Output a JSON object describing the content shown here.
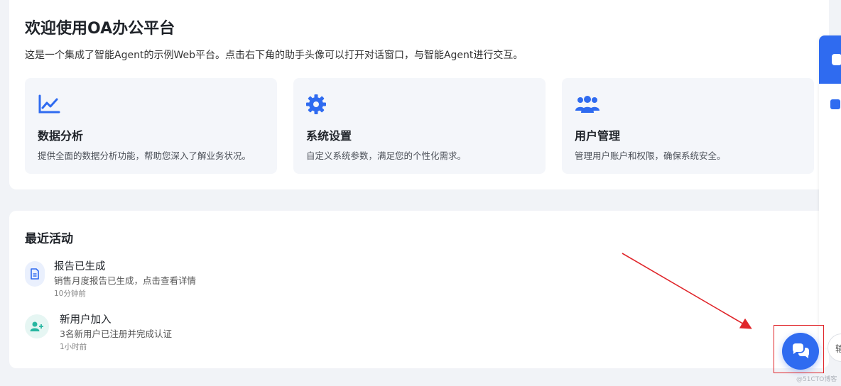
{
  "welcome": {
    "title": "欢迎使用OA办公平台",
    "subtitle": "这是一个集成了智能Agent的示例Web平台。点击右下角的助手头像可以打开对话窗口，与智能Agent进行交互。"
  },
  "features": [
    {
      "icon": "line-chart-icon",
      "title": "数据分析",
      "desc": "提供全面的数据分析功能，帮助您深入了解业务状况。"
    },
    {
      "icon": "gear-icon",
      "title": "系统设置",
      "desc": "自定义系统参数，满足您的个性化需求。"
    },
    {
      "icon": "users-icon",
      "title": "用户管理",
      "desc": "管理用户账户和权限，确保系统安全。"
    }
  ],
  "activity": {
    "title": "最近活动",
    "items": [
      {
        "icon": "document-icon",
        "title": "报告已生成",
        "desc": "销售月度报告已生成，点击查看详情",
        "time": "10分钟前"
      },
      {
        "icon": "user-plus-icon",
        "title": "新用户加入",
        "desc": "3名新用户已注册并完成认证",
        "time": "1小时前"
      }
    ]
  },
  "side_pill": {
    "label": "输"
  },
  "watermark": "@51CTO博客",
  "colors": {
    "accent": "#2f6bf0",
    "highlight": "#e0262b",
    "success": "#27b6a0"
  }
}
